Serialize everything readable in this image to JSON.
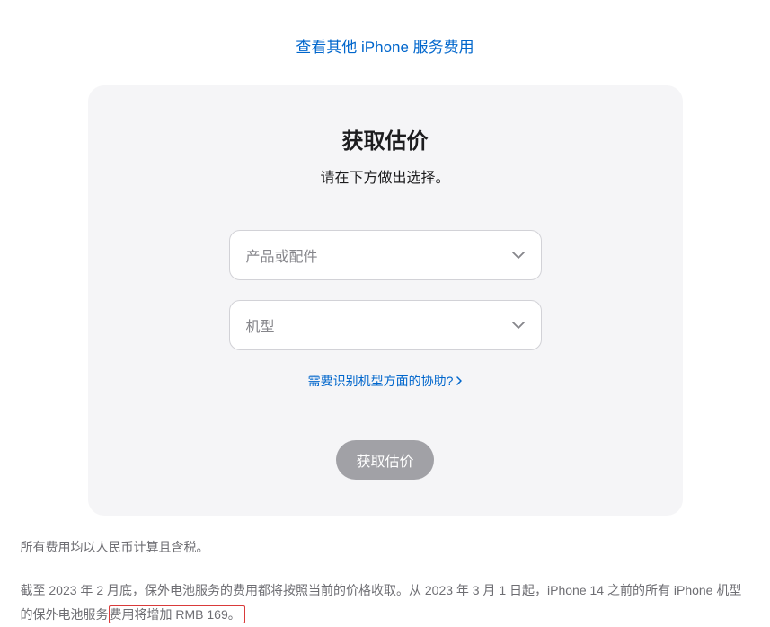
{
  "topLink": {
    "text": "查看其他 iPhone 服务费用"
  },
  "card": {
    "title": "获取估价",
    "subtitle": "请在下方做出选择。",
    "select1": {
      "placeholder": "产品或配件"
    },
    "select2": {
      "placeholder": "机型"
    },
    "helpLink": "需要识别机型方面的协助?",
    "button": "获取估价"
  },
  "footnotes": {
    "line1": "所有费用均以人民币计算且含税。",
    "line2_part1": "截至 2023 年 2 月底，保外电池服务的费用都将按照当前的价格收取。从 2023 年 3 月 1 日起，iPhone 14 之前的所有 iPhone 机型的保外电池服务",
    "line2_highlight": "费用将增加 RMB 169。"
  }
}
